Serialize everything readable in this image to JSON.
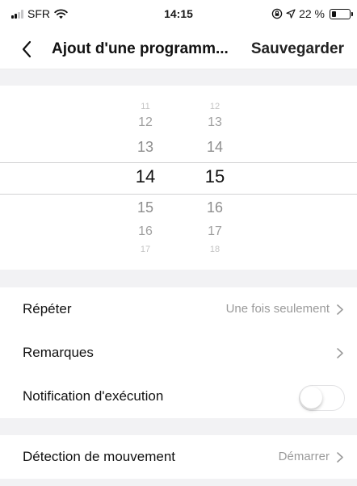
{
  "status_bar": {
    "carrier": "SFR",
    "time": "14:15",
    "battery_percent": "22 %"
  },
  "header": {
    "title": "Ajout d'une programm...",
    "save_label": "Sauvegarder"
  },
  "time_picker": {
    "hours": [
      "11",
      "12",
      "13",
      "14",
      "15",
      "16",
      "17"
    ],
    "minutes": [
      "12",
      "13",
      "14",
      "15",
      "16",
      "17",
      "18"
    ],
    "selected_hour": "14",
    "selected_minute": "15"
  },
  "settings": {
    "repeat": {
      "label": "Répéter",
      "value": "Une fois seulement"
    },
    "remarks": {
      "label": "Remarques"
    },
    "notification": {
      "label": "Notification d'exécution",
      "enabled": false
    },
    "motion": {
      "label": "Détection de mouvement",
      "value": "Démarrer"
    }
  },
  "icons": {
    "signal": "signal-icon",
    "wifi": "wifi-icon",
    "rotation_lock": "rotation-lock-icon",
    "location": "location-icon",
    "battery": "battery-icon",
    "back": "back-chevron-icon",
    "chevron": "chevron-right-icon"
  }
}
